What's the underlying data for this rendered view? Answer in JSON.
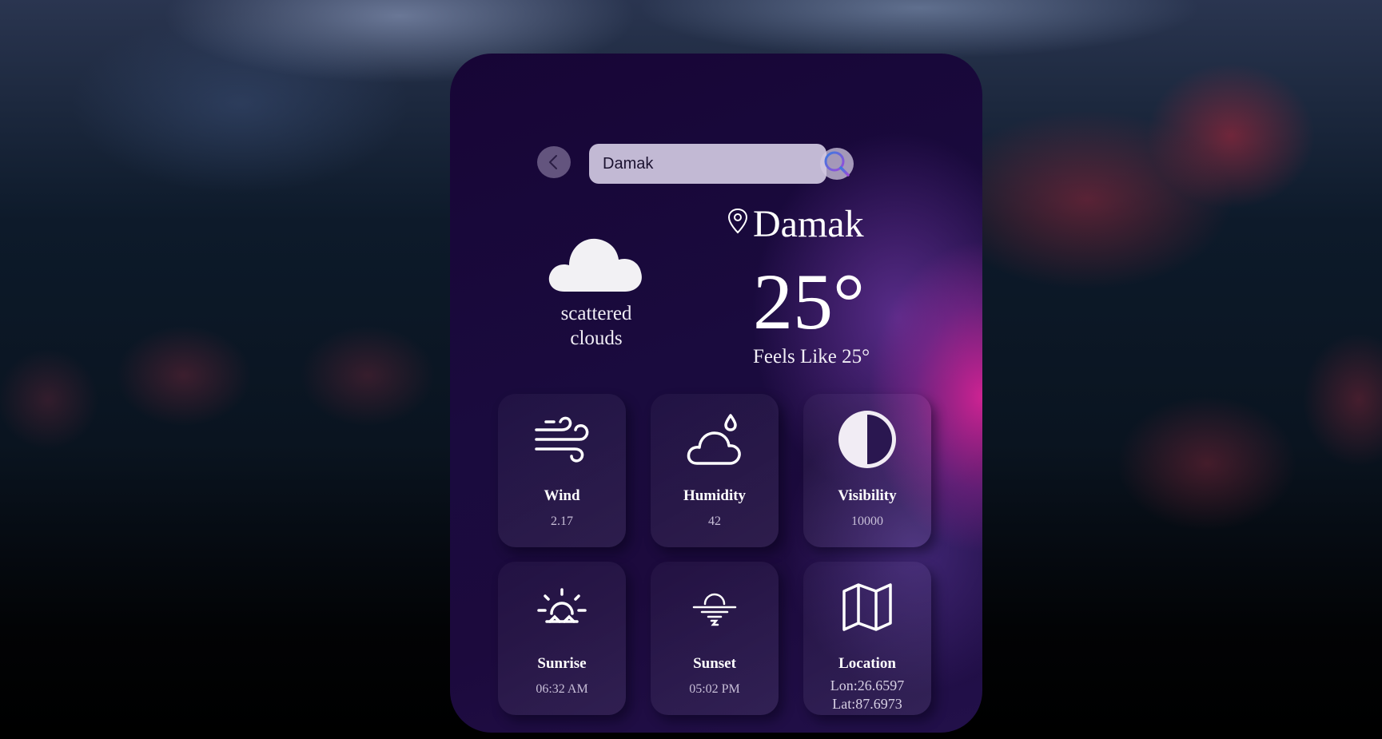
{
  "search": {
    "value": "Damak",
    "back_icon": "chevron-left-icon",
    "search_icon": "search-icon"
  },
  "current": {
    "icon": "cloud-icon",
    "description_line1": "scattered",
    "description_line2": "clouds",
    "location_icon": "map-pin-icon",
    "city": "Damak",
    "temperature": "25°",
    "feels_like": "Feels Like 25°"
  },
  "details": {
    "wind": {
      "icon": "wind-icon",
      "label": "Wind",
      "value": "2.17"
    },
    "humidity": {
      "icon": "humidity-icon",
      "label": "Humidity",
      "value": "42"
    },
    "visibility": {
      "icon": "visibility-icon",
      "label": "Visibility",
      "value": "10000"
    },
    "sunrise": {
      "icon": "sunrise-icon",
      "label": "Sunrise",
      "value": "06:32 AM"
    },
    "sunset": {
      "icon": "sunset-icon",
      "label": "Sunset",
      "value": "05:02 PM"
    },
    "location": {
      "icon": "map-icon",
      "label": "Location",
      "lon": "Lon:26.6597",
      "lat": "Lat:87.6973"
    }
  },
  "colors": {
    "card_base": "#1a0b3e",
    "accent_pink": "#d6249a",
    "input_bg": "#c2b9d4"
  }
}
